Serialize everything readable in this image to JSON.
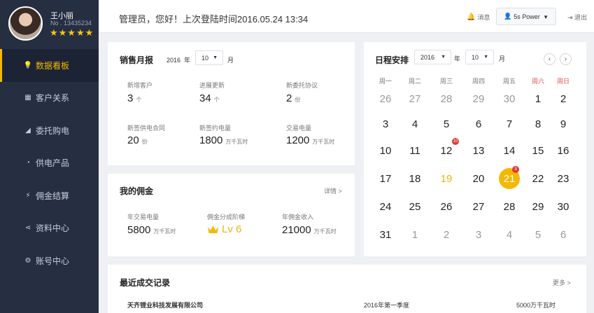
{
  "profile": {
    "name": "王小丽",
    "number": "No . 13435234",
    "stars": "★★★★★"
  },
  "menu": [
    {
      "label": "数据看板",
      "icon": "lightbulb-icon",
      "glyph": "💡",
      "active": true
    },
    {
      "label": "客户关系",
      "icon": "grid-icon",
      "glyph": "▦"
    },
    {
      "label": "委托购电",
      "icon": "chart-icon",
      "glyph": "◢"
    },
    {
      "label": "供电产品",
      "icon": "pie-icon",
      "glyph": "◔"
    },
    {
      "label": "佣金结算",
      "icon": "bolt-icon",
      "glyph": "⚡"
    },
    {
      "label": "资料中心",
      "icon": "share-icon",
      "glyph": "⋖"
    },
    {
      "label": "账号中心",
      "icon": "gear-icon",
      "glyph": "⚙"
    }
  ],
  "topbar": {
    "greeting": "管理员，您好！上次登陆时间2016.05.24 13:34",
    "message_label": "消息",
    "user_label": "5s Power",
    "logout_label": "退出"
  },
  "sales": {
    "title": "销售月报",
    "year": "2016",
    "year_suffix": "年",
    "month": "10",
    "month_suffix": "月",
    "stats": [
      {
        "label": "新增客户",
        "value": "3",
        "unit": "个"
      },
      {
        "label": "进展更新",
        "value": "34",
        "unit": "个"
      },
      {
        "label": "新委托协议",
        "value": "2",
        "unit": "份"
      },
      {
        "label": "新签供电合同",
        "value": "20",
        "unit": "份"
      },
      {
        "label": "新签约电量",
        "value": "1800",
        "unit": "万千瓦时"
      },
      {
        "label": "交易电量",
        "value": "1200",
        "unit": "万千瓦时"
      }
    ]
  },
  "commission": {
    "title": "我的佣金",
    "detail_label": "详情 >",
    "annual_label": "年交易电量",
    "annual_value": "5800",
    "annual_unit": "万千瓦时",
    "tier_label": "佣金分成阶梯",
    "tier_value": "Lv 6",
    "income_label": "年佣金收入",
    "income_value": "21000",
    "income_unit": "万千瓦时"
  },
  "calendar": {
    "title": "日程安排",
    "year": "2016",
    "year_suffix": "年",
    "month": "10",
    "month_suffix": "月",
    "weekdays": [
      "周一",
      "周二",
      "周三",
      "周四",
      "周五",
      "周六",
      "周日"
    ],
    "rows": [
      [
        "26",
        "27",
        "28",
        "29",
        "30",
        "1",
        "2"
      ],
      [
        "3",
        "4",
        "5",
        "6",
        "7",
        "8",
        "9"
      ],
      [
        "10",
        "11",
        "12",
        "13",
        "14",
        "15",
        "16"
      ],
      [
        "17",
        "18",
        "19",
        "20",
        "21",
        "22",
        "23"
      ],
      [
        "24",
        "25",
        "26",
        "27",
        "28",
        "29",
        "30"
      ],
      [
        "31",
        "1",
        "2",
        "3",
        "4",
        "5",
        "6"
      ]
    ],
    "badge_12": "10",
    "badge_21": "3"
  },
  "transactions": {
    "title": "最近成交记录",
    "more_label": "更多 >",
    "rows": [
      {
        "company": "天齐锂业科技发展有限公司",
        "period": "2016年第一季度",
        "amount": "5000万千瓦时"
      }
    ]
  },
  "colors": {
    "accent": "#f5b800",
    "sidebar": "#262e42",
    "badge": "#e53935",
    "weekend": "#e35050"
  }
}
